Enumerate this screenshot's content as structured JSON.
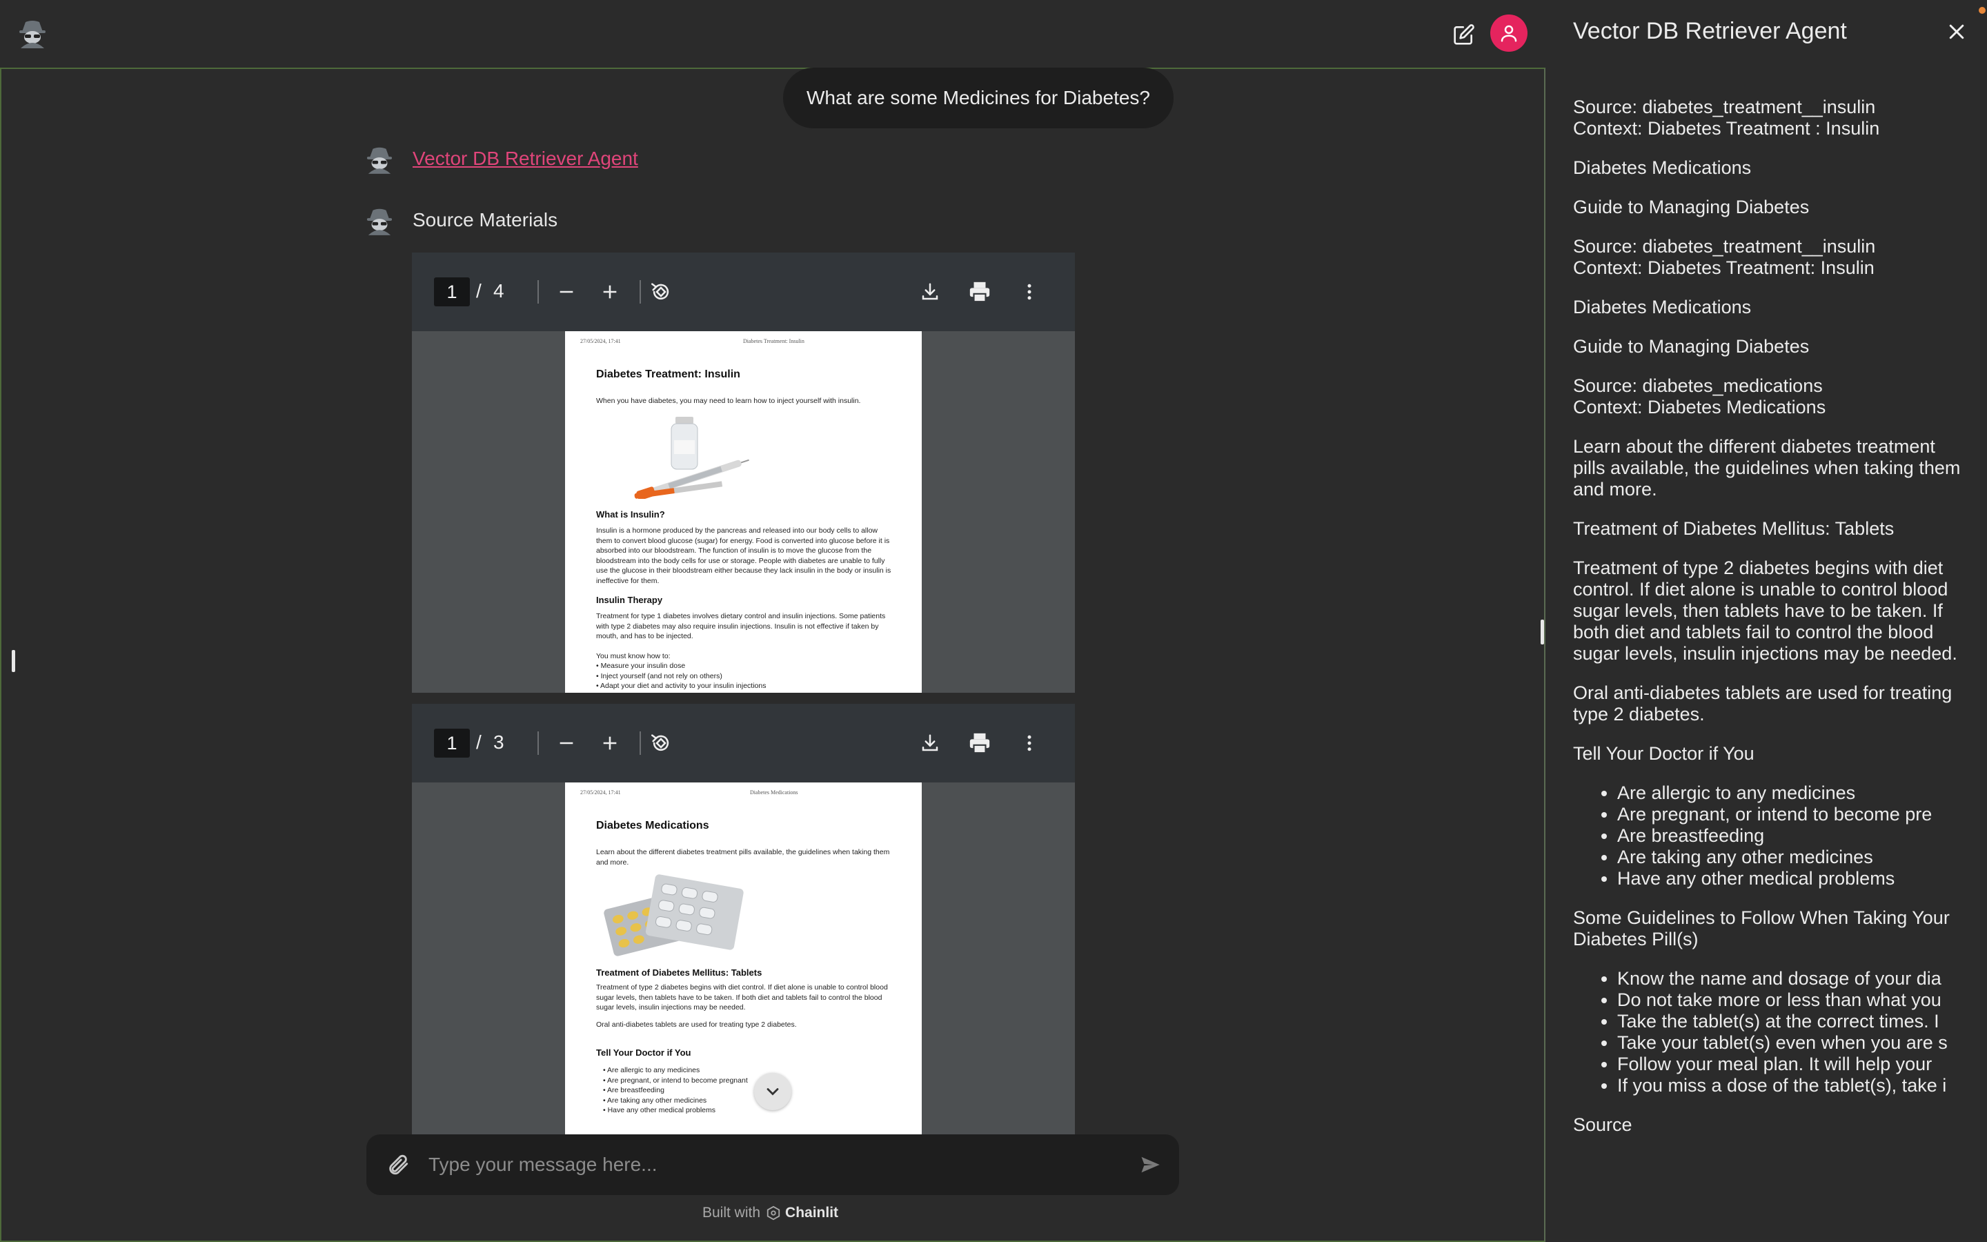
{
  "app": {
    "logo_icon": "spy-agent-icon",
    "brand_color": "#e5245e"
  },
  "chat": {
    "user_message": "What are some Medicines for Diabetes?",
    "steps": [
      {
        "label": "Vector DB Retriever Agent",
        "icon": "spy-agent-icon"
      },
      {
        "label": "Source Materials",
        "icon": "spy-agent-icon"
      }
    ]
  },
  "pdf_viewers": [
    {
      "page_current": "1",
      "page_separator": "/",
      "page_total": "4",
      "header_left": "27/05/2024, 17:41",
      "header_center": "Diabetes Treatment: Insulin",
      "title": "Diabetes Treatment: Insulin",
      "intro": "When you have diabetes, you may need to learn how to inject yourself with insulin.",
      "section1_title": "What is Insulin?",
      "section1_text": "Insulin is a hormone produced by the pancreas and released into our body cells to allow them to convert blood glucose (sugar) for energy. Food is converted into glucose before it is absorbed into our bloodstream. The function of insulin is to move the glucose from the bloodstream into the body cells for use or storage. People with diabetes are unable to fully use the glucose in their bloodstream either because they lack insulin in the body or insulin is ineffective for them.",
      "section2_title": "Insulin Therapy",
      "section2_text": "Treatment for type 1 diabetes involves dietary control and insulin injections. Some patients with type 2 diabetes may also require insulin injections. Insulin is not effective if taken by mouth, and has to be injected.",
      "list_intro": "You must know how to:",
      "list": [
        "Measure your insulin dose",
        "Inject yourself (and not rely on others)",
        "Adapt your diet and activity to your insulin injections"
      ]
    },
    {
      "page_current": "1",
      "page_separator": "/",
      "page_total": "3",
      "header_left": "27/05/2024, 17:41",
      "header_center": "Diabetes Medications",
      "title": "Diabetes Medications",
      "intro": "Learn about the different diabetes treatment pills available, the guidelines when taking them and more.",
      "section1_title": "Treatment of Diabetes Mellitus: Tablets",
      "section1_text": "Treatment of type 2 diabetes begins with diet control. If diet alone is unable to control blood sugar levels, then tablets have to be taken. If both diet and tablets fail to control the blood sugar levels, insulin injections may be needed.",
      "section1_text2": "Oral anti-diabetes tablets are used for treating type 2 diabetes.",
      "section2_title": "Tell Your Doctor if You",
      "list": [
        "Are allergic to any medicines",
        "Are pregnant, or intend to become pregnant",
        "Are breastfeeding",
        "Are taking any other medicines",
        "Have any other medical problems"
      ]
    }
  ],
  "composer": {
    "placeholder": "Type your message here...",
    "built_with": "Built with",
    "brand": "Chainlit"
  },
  "panel": {
    "title": "Vector DB Retriever Agent",
    "p1_line1": "Source: diabetes_treatment__insulin",
    "p1_line2": "Context: Diabetes Treatment : Insulin",
    "p2": "Diabetes Medications",
    "p3": "Guide to Managing Diabetes",
    "p4_line1": "Source: diabetes_treatment__insulin",
    "p4_line2": "Context: Diabetes Treatment: Insulin",
    "p5": "Diabetes Medications",
    "p6": "Guide to Managing Diabetes",
    "p7_line1": "Source: diabetes_medications",
    "p7_line2": "Context: Diabetes Medications",
    "p8": "Learn about the different diabetes treatment pills available, the guidelines when taking them and more.",
    "p9": "Treatment of Diabetes Mellitus: Tablets",
    "p10": "Treatment of type 2 diabetes begins with diet control. If diet alone is unable to control blood sugar levels, then tablets have to be taken. If both diet and tablets fail to control the blood sugar levels, insulin injections may be needed.",
    "p11": "Oral anti-diabetes tablets are used for treating type 2 diabetes.",
    "p12": "Tell Your Doctor if You",
    "list1": [
      "Are allergic to any medicines",
      "Are pregnant, or intend to become pre",
      "Are breastfeeding",
      "Are taking any other medicines",
      "Have any other medical problems"
    ],
    "p13": "Some Guidelines to Follow When Taking Your Diabetes Pill(s)",
    "list2": [
      "Know the name and dosage of your dia",
      "Do not take more or less than what you",
      "Take the tablet(s) at the correct times. I",
      "Take your tablet(s) even when you are s",
      "Follow your meal plan. It will help your",
      "If you miss a dose of the tablet(s), take i"
    ],
    "p14": "Source"
  }
}
